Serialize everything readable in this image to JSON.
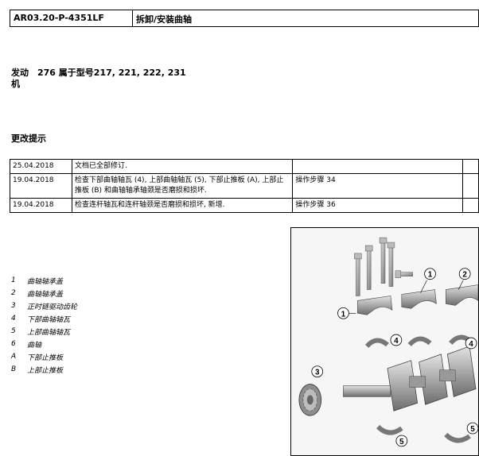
{
  "header": {
    "doc_id": "AR03.20-P-4351LF",
    "title": "拆卸/安装曲轴"
  },
  "engine": {
    "label": "发动机",
    "models": "276 属于型号217, 221, 222, 231"
  },
  "changes": {
    "title": "更改提示",
    "rows": [
      {
        "date": "25.04.2018",
        "desc": "文档已全部修订.",
        "step": ""
      },
      {
        "date": "19.04.2018",
        "desc": "检查下部曲轴轴瓦 (4), 上部曲轴轴瓦 (5), 下部止推板 (A), 上部止推板 (B) 和曲轴轴承轴颈是否磨损和损坏.",
        "step": "操作步骤 34"
      },
      {
        "date": "19.04.2018",
        "desc": "检查连杆轴瓦和连杆轴颈是否磨损和损坏, 新增.",
        "step": "操作步骤 36"
      }
    ]
  },
  "legend": [
    {
      "num": "1",
      "text": "曲轴轴承盖"
    },
    {
      "num": "2",
      "text": "曲轴轴承盖"
    },
    {
      "num": "3",
      "text": "正时链驱动齿轮"
    },
    {
      "num": "4",
      "text": "下部曲轴轴瓦"
    },
    {
      "num": "5",
      "text": "上部曲轴轴瓦"
    },
    {
      "num": "6",
      "text": "曲轴"
    },
    {
      "num": "A",
      "text": "下部止推板"
    },
    {
      "num": "B",
      "text": "上部止推板"
    }
  ],
  "figure": {
    "callouts": [
      "1",
      "2",
      "3",
      "4",
      "4",
      "4",
      "5",
      "5"
    ]
  }
}
